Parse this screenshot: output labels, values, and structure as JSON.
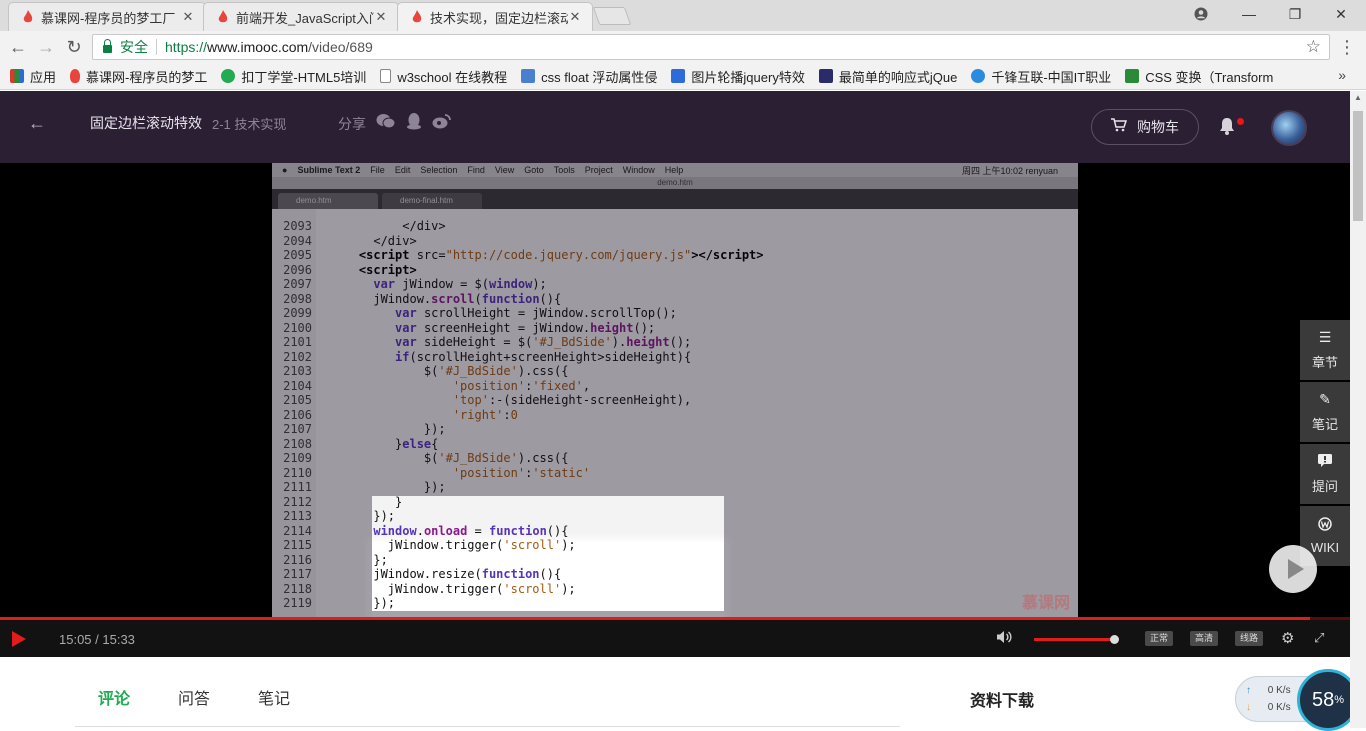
{
  "browser": {
    "tabs": [
      {
        "title": "慕课网-程序员的梦工厂",
        "active": false
      },
      {
        "title": "前端开发_JavaScript入门",
        "active": false
      },
      {
        "title": "技术实现，固定边栏滚动",
        "active": true
      }
    ],
    "secure_label": "安全",
    "url_scheme": "https://",
    "url_host": "www.imooc.com",
    "url_path": "/video/689",
    "bookmarks": [
      {
        "label": "应用",
        "color": "#d63c2e"
      },
      {
        "label": "慕课网-程序员的梦工",
        "color": "#e8453c"
      },
      {
        "label": "扣丁学堂-HTML5培训",
        "color": "#22aa55"
      },
      {
        "label": "w3school 在线教程",
        "color": "#888888"
      },
      {
        "label": "css float 浮动属性侵",
        "color": "#4a7fd0"
      },
      {
        "label": "图片轮播jquery特效",
        "color": "#2d6bd8"
      },
      {
        "label": "最简单的响应式jQue",
        "color": "#2b2b6b"
      },
      {
        "label": "千锋互联-中国IT职业",
        "color": "#2b8cdf"
      },
      {
        "label": "CSS 变换（Transform",
        "color": "#2a8a3a"
      }
    ]
  },
  "header": {
    "course_title": "固定边栏滚动特效",
    "lesson": "2-1 技术实现",
    "share_label": "分享",
    "cart_label": "购物车"
  },
  "screencast": {
    "menubar": [
      "Sublime Text 2",
      "File",
      "Edit",
      "Selection",
      "Find",
      "View",
      "Goto",
      "Tools",
      "Project",
      "Window",
      "Help"
    ],
    "menubar_right": "周四 上午10:02   renyuan",
    "window_title": "demo.htm",
    "tabs": [
      "demo.htm",
      "demo-final.htm"
    ],
    "watermark": "慕课网"
  },
  "side_panel": [
    {
      "label": "章节",
      "icon": "list-icon"
    },
    {
      "label": "笔记",
      "icon": "pencil-icon"
    },
    {
      "label": "提问",
      "icon": "question-icon"
    },
    {
      "label": "WIKI",
      "icon": "wiki-icon"
    }
  ],
  "player": {
    "time": "15:05 / 15:33",
    "progress": 0.97,
    "volume": 1.0,
    "chips": [
      "正常",
      "高清",
      "线路"
    ]
  },
  "bottom_tabs": [
    "评论",
    "问答",
    "笔记"
  ],
  "downloads_label": "资料下载",
  "speed": {
    "up": "0 K/s",
    "down": "0 K/s"
  },
  "cpu": {
    "value": "58",
    "unit": "%"
  }
}
